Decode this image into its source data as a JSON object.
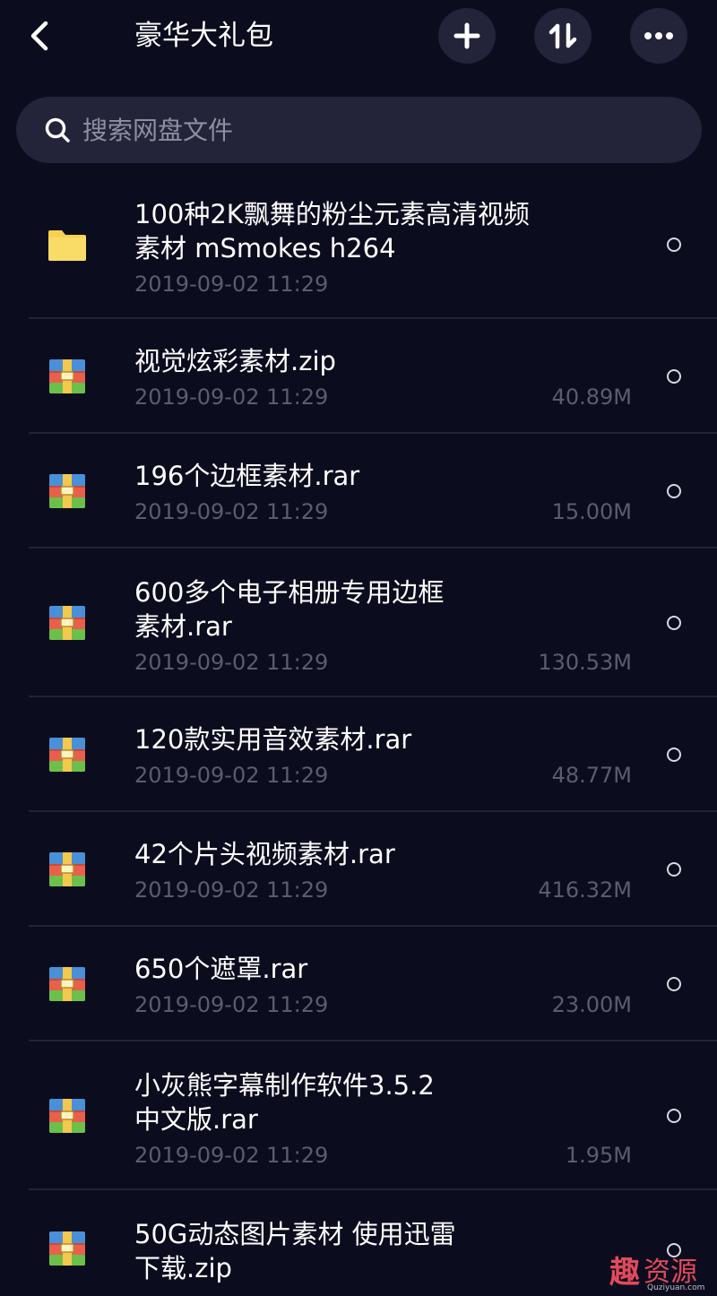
{
  "header": {
    "title": "豪华大礼包",
    "back_icon": "chevron-left-icon",
    "add_icon": "plus-icon",
    "sort_icon": "sort-icon",
    "more_icon": "more-icon"
  },
  "search": {
    "placeholder": "搜索网盘文件",
    "icon": "search-icon"
  },
  "files": [
    {
      "type": "folder",
      "name_line1": "100种2K飘舞的粉尘元素高清视频",
      "name_line2": "素材 mSmokes h264",
      "date": "2019-09-02 11:29",
      "size": ""
    },
    {
      "type": "archive",
      "name_line1": "视觉炫彩素材.zip",
      "name_line2": "",
      "date": "2019-09-02 11:29",
      "size": "40.89M"
    },
    {
      "type": "archive",
      "name_line1": "196个边框素材.rar",
      "name_line2": "",
      "date": "2019-09-02 11:29",
      "size": "15.00M"
    },
    {
      "type": "archive",
      "name_line1": "600多个电子相册专用边框",
      "name_line2": "素材.rar",
      "date": "2019-09-02 11:29",
      "size": "130.53M"
    },
    {
      "type": "archive",
      "name_line1": "120款实用音效素材.rar",
      "name_line2": "",
      "date": "2019-09-02 11:29",
      "size": "48.77M"
    },
    {
      "type": "archive",
      "name_line1": "42个片头视频素材.rar",
      "name_line2": "",
      "date": "2019-09-02 11:29",
      "size": "416.32M"
    },
    {
      "type": "archive",
      "name_line1": "650个遮罩.rar",
      "name_line2": "",
      "date": "2019-09-02 11:29",
      "size": "23.00M"
    },
    {
      "type": "archive",
      "name_line1": "小灰熊字幕制作软件3.5.2",
      "name_line2": "中文版.rar",
      "date": "2019-09-02 11:29",
      "size": "1.95M"
    },
    {
      "type": "archive",
      "name_line1": "50G动态图片素材 使用迅雷",
      "name_line2": "下载.zip",
      "date": "",
      "size": ""
    }
  ],
  "watermark": {
    "char": "趣",
    "text": "资源",
    "sub": "Quziyuan.com"
  },
  "colors": {
    "background": "#0c0c1f",
    "button_bg": "#23233a",
    "folder": "#f7d154",
    "muted_text": "#5c5c70",
    "watermark": "#e24a5c"
  }
}
